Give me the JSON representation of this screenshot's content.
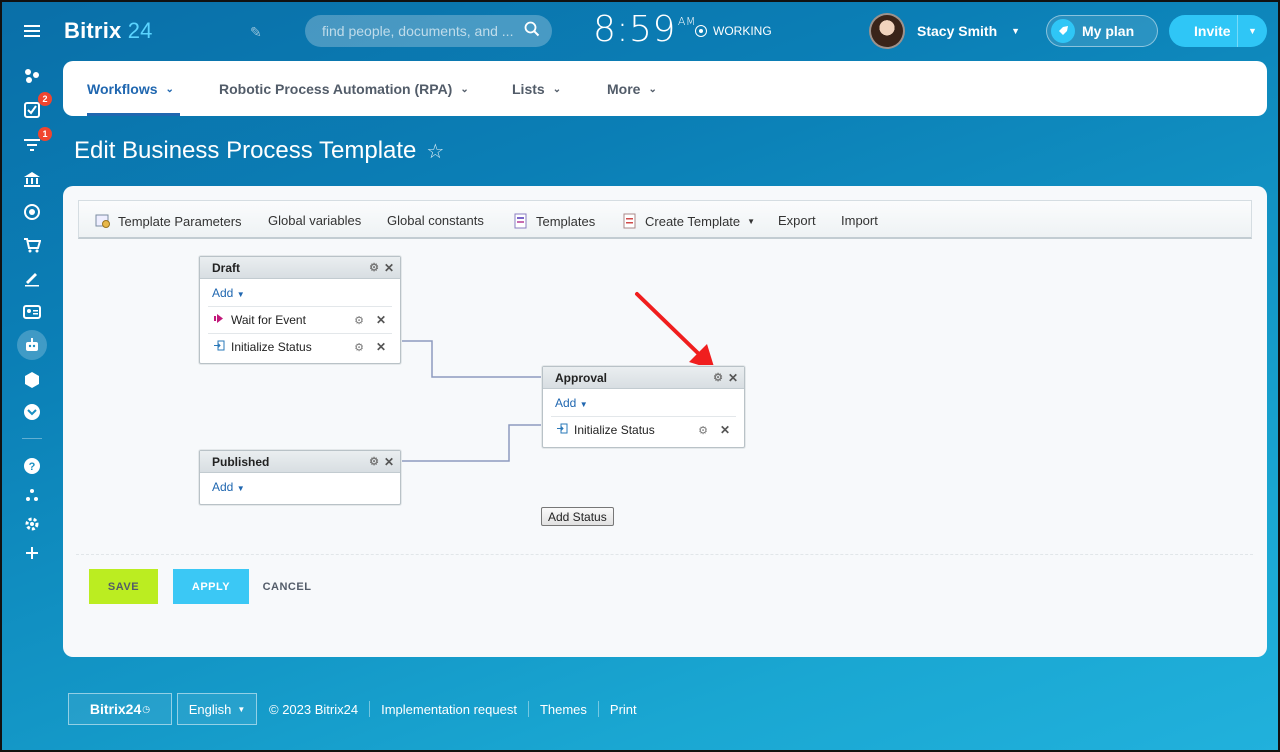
{
  "app": {
    "name": "Bitrix",
    "name_num": "24"
  },
  "header": {
    "search_placeholder": "find people, documents, and ...",
    "clock": "8:59",
    "ampm": "AM",
    "work_status": "WORKING",
    "user_name": "Stacy Smith",
    "plan_label": "My plan",
    "invite_label": "Invite"
  },
  "left_menu": {
    "badges": {
      "tasks": "2",
      "feed": "1"
    }
  },
  "nav": {
    "items": [
      {
        "label": "Workflows"
      },
      {
        "label": "Robotic Process Automation (RPA)"
      },
      {
        "label": "Lists"
      },
      {
        "label": "More"
      }
    ]
  },
  "page": {
    "title": "Edit Business Process Template"
  },
  "toolbar": {
    "items": [
      {
        "label": "Template Parameters"
      },
      {
        "label": "Global variables"
      },
      {
        "label": "Global constants"
      },
      {
        "label": "Templates"
      },
      {
        "label": "Create Template"
      },
      {
        "label": "Export"
      },
      {
        "label": "Import"
      }
    ]
  },
  "states": {
    "draft": {
      "title": "Draft",
      "add": "Add",
      "activities": [
        "Wait for Event",
        "Initialize Status"
      ]
    },
    "approval": {
      "title": "Approval",
      "add": "Add",
      "activities": [
        "Initialize Status"
      ]
    },
    "published": {
      "title": "Published",
      "add": "Add"
    }
  },
  "add_status_label": "Add Status",
  "actions": {
    "save": "SAVE",
    "apply": "APPLY",
    "cancel": "CANCEL"
  },
  "footer": {
    "logo": "Bitrix24",
    "language": "English",
    "copyright": "© 2023 Bitrix24",
    "links": [
      "Implementation request",
      "Themes",
      "Print"
    ]
  },
  "colors": {
    "accent": "#2067b0",
    "save": "#bbed21",
    "apply": "#3bc8f5",
    "annotation_arrow": "#f01e1e"
  }
}
